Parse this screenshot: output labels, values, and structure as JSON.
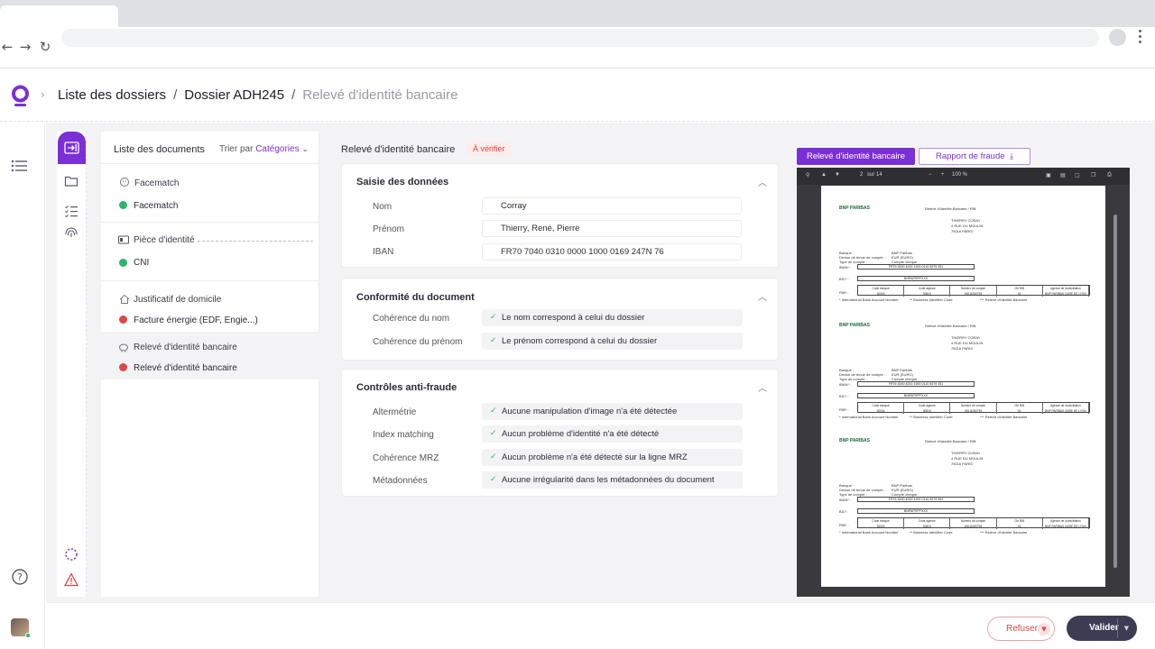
{
  "breadcrumb": {
    "items": [
      "Liste des dossiers",
      "Dossier ADH245",
      "Relevé d'identité bancaire"
    ],
    "separator": "/"
  },
  "documents_panel": {
    "title": "Liste des documents",
    "sort_prefix": "Trier par",
    "sort_value": "Catégories",
    "groups": [
      {
        "title": "Facematch",
        "icon": "face-icon",
        "items": [
          {
            "label": "Facematch",
            "status": "green"
          }
        ]
      },
      {
        "title": "Pièce d'identité",
        "icon": "id-card-icon",
        "items": [
          {
            "label": "CNI",
            "status": "green"
          }
        ]
      },
      {
        "title": "Justificatif de domicile",
        "icon": "home-icon",
        "items": [
          {
            "label": "Facture énergie (EDF, Engie...)",
            "status": "red"
          }
        ]
      },
      {
        "title": "Relevé d'identité bancaire",
        "icon": "piggy-bank-icon",
        "items": [
          {
            "label": "Relevé d'identité bancaire",
            "status": "red"
          }
        ]
      }
    ]
  },
  "main": {
    "title": "Relevé d'identité bancaire",
    "status_badge": "À vérifier",
    "data_entry": {
      "title": "Saisie des données",
      "fields": [
        {
          "label": "Nom",
          "value": "Corray"
        },
        {
          "label": "Prénom",
          "value": "Thierry, René, Pierre"
        },
        {
          "label": "IBAN",
          "value": "FR70 7040 0310 0000 1000 0169 247N 76"
        }
      ]
    },
    "conformity": {
      "title": "Conformité du document",
      "checks": [
        {
          "label": "Cohérence du nom",
          "value": "Le nom correspond à celui du dossier"
        },
        {
          "label": "Cohérence du prénom",
          "value": "Le prénom correspond à celui du dossier"
        }
      ]
    },
    "fraud": {
      "title": "Contrôles anti-fraude",
      "checks": [
        {
          "label": "Altermétrie",
          "value": "Aucune manipulation d'image n'a été détectée"
        },
        {
          "label": "Index matching",
          "value": "Aucun problème d'identité n'a été détecté"
        },
        {
          "label": "Cohérence MRZ",
          "value": "Aucun problème n'a été détecté sur la ligne MRZ"
        },
        {
          "label": "Métadonnées",
          "value": "Aucune irrégularité dans les métadonnées du document"
        }
      ]
    }
  },
  "preview": {
    "tab_active": "Relevé d'identité bancaire",
    "tab_fraud": "Rapport de fraude",
    "viewer_page": "2",
    "viewer_page_total": "sur 14",
    "viewer_zoom": "100 %",
    "doc": {
      "bank": "BNP PARIBAS",
      "header": "Relevé d'Identité Bancaire / RIB",
      "holder_lines": [
        "THIERRY CORAY",
        "4 RUE DU MOULIN",
        "75016 PARIS"
      ],
      "meta_lines": [
        "Banque :",
        "Devise de tenue de compte :",
        "Type de compte :"
      ],
      "meta_values": [
        "BNP Paribas",
        "EUR (EURO)",
        "Compte chèque"
      ],
      "iban_label": "IBAN* :",
      "iban": "FR76 3000 4000 1900 0110 5079 351",
      "bic_label": "BIC* :",
      "bic": "BNPAFRPPXXX",
      "table_headers": [
        "Code banque",
        "Code agence",
        "Numéro de compte",
        "Clé RIB",
        "Agence de domiciliation"
      ],
      "table_values": [
        "30004",
        "00819",
        "00011050793",
        "51",
        "BNP PARIBAS GARE DE LYON"
      ],
      "rib_label": "RIB* :",
      "footnotes": [
        "* International Bank Account Number",
        "** Business Identifier Code",
        "*** Relevé d'Identité Bancaire"
      ]
    }
  },
  "footer": {
    "refuse_label": "Refuser",
    "validate_label": "Valider"
  },
  "colors": {
    "brand": "#7b2fd6",
    "success": "#2fb36b",
    "danger": "#e04646",
    "dark_button": "#3c3c55"
  }
}
